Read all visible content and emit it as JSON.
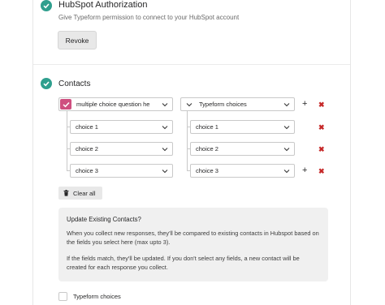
{
  "hubspot_auth": {
    "title": "HubSpot Authorization",
    "description": "Give Typeform permission to connect to your HubSpot account",
    "revoke_label": "Revoke"
  },
  "contacts": {
    "title": "Contacts",
    "question_field": "multiple choice question he",
    "typeform_field": "Typeform choices",
    "rows": [
      {
        "left": "choice 1",
        "right": "choice 1"
      },
      {
        "left": "choice 2",
        "right": "choice 2"
      },
      {
        "left": "choice 3",
        "right": "choice 3"
      }
    ],
    "clear_all_label": "Clear all"
  },
  "update_info": {
    "title": "Update Existing Contacts?",
    "paragraph1": "When you collect new responses, they'll be compared to existing contacts in Hubspot based on the fields you select here (max upto 3).",
    "paragraph2": "If the fields match, they'll be updated. If you don't select any fields, a new contact will be created for each response you collect."
  },
  "typeform_choices_checkbox": {
    "label": "Typeform choices",
    "checked": false
  },
  "symbols": {
    "plus": "+",
    "remove": "✖"
  },
  "colors": {
    "accent_teal": "#2f9f8e",
    "question_pink": "#cf4f80",
    "remove_red": "#c62828"
  }
}
